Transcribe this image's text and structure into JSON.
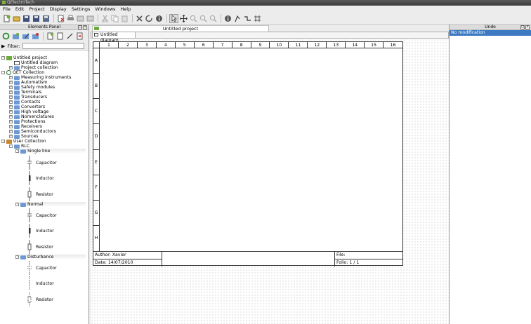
{
  "window": {
    "title": "QElectroTech"
  },
  "menu": [
    "File",
    "Edit",
    "Project",
    "Display",
    "Settings",
    "Windows",
    "Help"
  ],
  "toolbar_icons": [
    "new-project-icon",
    "open-icon",
    "save-icon",
    "save-as-icon",
    "save-all-icon",
    "close-icon",
    "print-icon",
    "undo-icon",
    "redo-icon",
    "cut-icon",
    "copy-icon",
    "paste-icon",
    "delete-icon",
    "rotate-icon",
    "properties-icon",
    "select-icon",
    "move-icon",
    "zoom-in-icon",
    "zoom-out-icon",
    "zoom-fit-icon",
    "add-text-icon",
    "add-conductor-icon",
    "conductor-icon",
    "grid-icon"
  ],
  "elements_panel": {
    "title": "Elements Panel",
    "filter_label": "Filter:",
    "filter_value": "",
    "tree": [
      {
        "label": "Untitled project",
        "level": 0,
        "icon": "project",
        "toggle": "-"
      },
      {
        "label": "Untitled diagram",
        "level": 1,
        "icon": "diagram",
        "toggle": ""
      },
      {
        "label": "Project collection",
        "level": 1,
        "icon": "folder",
        "toggle": "+"
      },
      {
        "label": "QET Collection",
        "level": 0,
        "icon": "qet",
        "toggle": "-"
      },
      {
        "label": "Measuring instruments",
        "level": 1,
        "icon": "folder",
        "toggle": "+"
      },
      {
        "label": "Automatism",
        "level": 1,
        "icon": "folder",
        "toggle": "+"
      },
      {
        "label": "Safety modules",
        "level": 1,
        "icon": "folder",
        "toggle": "+"
      },
      {
        "label": "Terminals",
        "level": 1,
        "icon": "folder",
        "toggle": "+"
      },
      {
        "label": "Transducers",
        "level": 1,
        "icon": "folder",
        "toggle": "+"
      },
      {
        "label": "Contacts",
        "level": 1,
        "icon": "folder",
        "toggle": "+"
      },
      {
        "label": "Converters",
        "level": 1,
        "icon": "folder",
        "toggle": "+"
      },
      {
        "label": "High voltage",
        "level": 1,
        "icon": "folder",
        "toggle": "+"
      },
      {
        "label": "Nomenclatures",
        "level": 1,
        "icon": "folder",
        "toggle": "+"
      },
      {
        "label": "Protections",
        "level": 1,
        "icon": "folder",
        "toggle": "+"
      },
      {
        "label": "Receivers",
        "level": 1,
        "icon": "folder",
        "toggle": "+"
      },
      {
        "label": "Semiconductors",
        "level": 1,
        "icon": "folder",
        "toggle": "+"
      },
      {
        "label": "Sources",
        "level": 1,
        "icon": "folder",
        "toggle": "+"
      },
      {
        "label": "User Collection",
        "level": 0,
        "icon": "home",
        "toggle": "-"
      },
      {
        "label": "RLC",
        "level": 1,
        "icon": "folder",
        "toggle": "-"
      }
    ],
    "groups": [
      {
        "label": "Single line",
        "elements": [
          "Capacitor",
          "Inductor",
          "Resistor"
        ]
      },
      {
        "label": "Normal",
        "elements": [
          "Capacitor",
          "Inductor",
          "Resistor"
        ]
      },
      {
        "label": "Disturbance",
        "elements": [
          "Capacitor",
          "Inductor",
          "Resistor"
        ]
      }
    ]
  },
  "project_tab": "Untitled project",
  "diagram_tab": "Untitled diagram",
  "diagram": {
    "columns": [
      "1",
      "2",
      "3",
      "4",
      "5",
      "6",
      "7",
      "8",
      "9",
      "10",
      "11",
      "12",
      "13",
      "14",
      "15",
      "16"
    ],
    "rows": [
      "A",
      "B",
      "C",
      "D",
      "E",
      "F",
      "G",
      "H"
    ],
    "titleblock": {
      "author": "Author: Xavier",
      "date": "Date: 14/07/2010",
      "file": "File:",
      "folio": "Folio: 1 / 1"
    }
  },
  "undo_panel": {
    "title": "Undo",
    "items": [
      "No modification"
    ]
  }
}
